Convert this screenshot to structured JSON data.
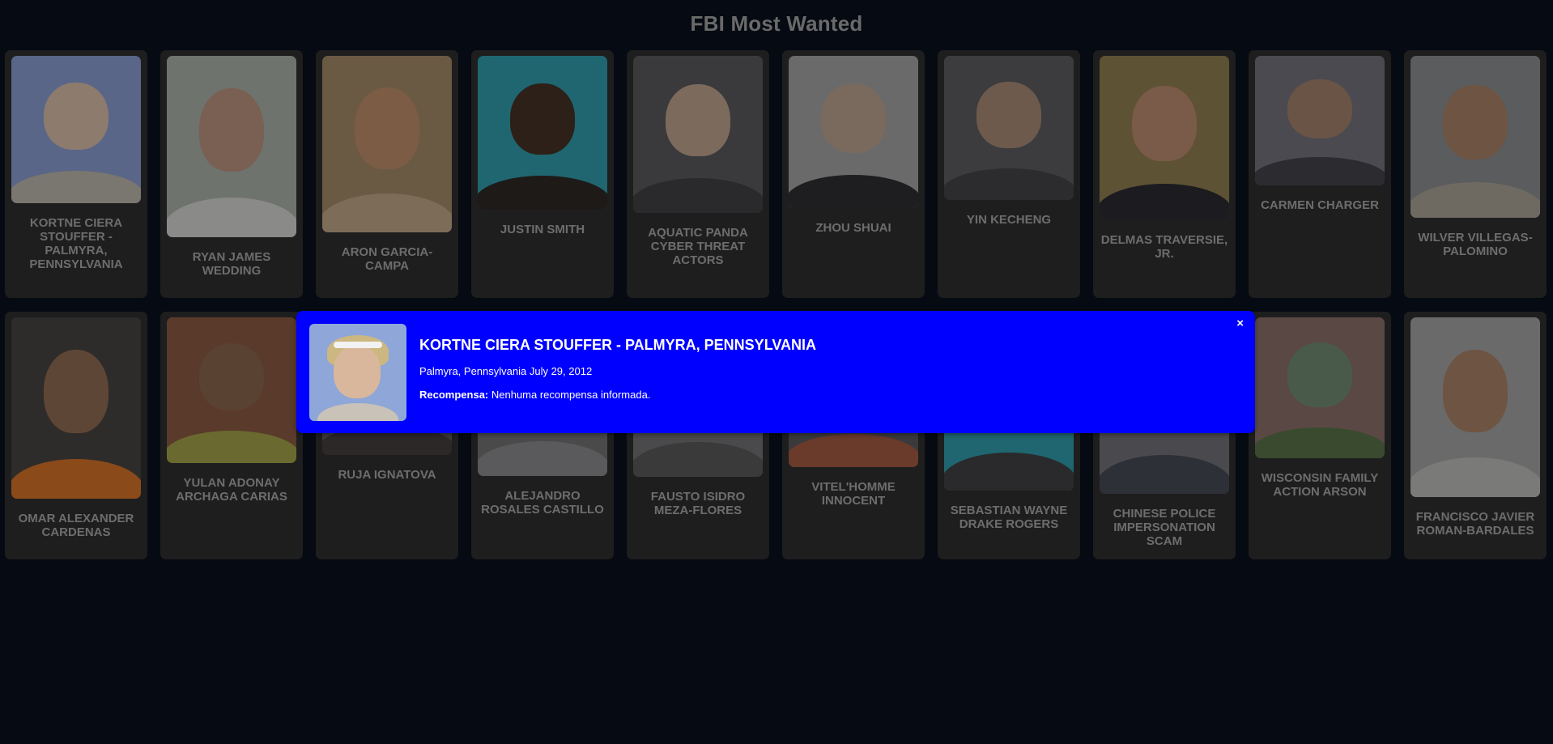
{
  "page": {
    "title": "FBI Most Wanted"
  },
  "cards": [
    {
      "name": "KORTNE CIERA STOUFFER - PALMYRA, PENNSYLVANIA",
      "photo_height": 182,
      "bg": "#5a6688",
      "skin": "#8d7b6e",
      "shirt": "#7a7670"
    },
    {
      "name": "RYAN JAMES WEDDING",
      "photo_height": 224,
      "bg": "#6e736e",
      "skin": "#7a6052",
      "shirt": "#8a8a88"
    },
    {
      "name": "ARON GARCIA-CAMPA",
      "photo_height": 218,
      "bg": "#6a5a44",
      "skin": "#7c5c44",
      "shirt": "#7c6c58"
    },
    {
      "name": "JUSTIN SMITH",
      "photo_height": 190,
      "bg": "#1f6670",
      "skin": "#2c2018",
      "shirt": "#1e1a18"
    },
    {
      "name": "AQUATIC PANDA CYBER THREAT ACTORS",
      "photo_height": 194,
      "bg": "#3a3a3c",
      "skin": "#7c6a5c",
      "shirt": "#2a2a2c"
    },
    {
      "name": "ZHOU SHUAI",
      "photo_height": 188,
      "bg": "#6a6a6a",
      "skin": "#7a6a5e",
      "shirt": "#1e1e20"
    },
    {
      "name": "YIN KECHENG",
      "photo_height": 178,
      "bg": "#3c3c3e",
      "skin": "#6e5a4c",
      "shirt": "#2c2c2e"
    },
    {
      "name": "DELMAS TRAVERSIE, JR.",
      "photo_height": 203,
      "bg": "#5e5234",
      "skin": "#7a5a48",
      "shirt": "#1c1c20"
    },
    {
      "name": "CARMEN CHARGER",
      "photo_height": 160,
      "bg": "#4a4a50",
      "skin": "#6a5446",
      "shirt": "#2c2c30"
    },
    {
      "name": "WILVER VILLEGAS-PALOMINO",
      "photo_height": 200,
      "bg": "#5a5c5e",
      "skin": "#6e5442",
      "shirt": "#6e6a62"
    },
    {
      "name": "OMAR ALEXANDER CARDENAS",
      "photo_height": 224,
      "bg": "#2e2c2a",
      "skin": "#5e4636",
      "shirt": "#8a4a1a"
    },
    {
      "name": "YULAN ADONAY ARCHAGA CARIAS",
      "photo_height": 180,
      "bg": "#5a3a2a",
      "skin": "#5a4232",
      "shirt": "#6a6a30"
    },
    {
      "name": "RUJA IGNATOVA",
      "photo_height": 170,
      "bg": "#3e3a3a",
      "skin": "#6e5a4c",
      "shirt": "#2c2828"
    },
    {
      "name": "ALEJANDRO ROSALES CASTILLO",
      "photo_height": 196,
      "bg": "#4a4a4a",
      "skin": "#6e5a4a",
      "shirt": "#5a5a5c"
    },
    {
      "name": "FAUSTO ISIDRO MEZA-FLORES",
      "photo_height": 197,
      "bg": "#4a4a4c",
      "skin": "#6a5240",
      "shirt": "#3a3a3a"
    },
    {
      "name": "VITEL'HOMME INNOCENT",
      "photo_height": 185,
      "bg": "#3a3a3c",
      "skin": "#3a2a20",
      "shirt": "#6a3a2a"
    },
    {
      "name": "SEBASTIAN WAYNE DRAKE ROGERS",
      "photo_height": 214,
      "bg": "#1f6670",
      "skin": "#7a6a5e",
      "shirt": "#2a2a2c"
    },
    {
      "name": "CHINESE POLICE IMPERSONATION SCAM",
      "photo_height": 218,
      "bg": "#4a4a4e",
      "skin": "#6a5a4c",
      "shirt": "#2e3038"
    },
    {
      "name": "WISCONSIN FAMILY ACTION ARSON",
      "photo_height": 174,
      "bg": "#5a4844",
      "skin": "#4a5a4a",
      "shirt": "#3a4a2e"
    },
    {
      "name": "FRANCISCO JAVIER ROMAN-BARDALES",
      "photo_height": 222,
      "bg": "#6a6a6a",
      "skin": "#6e5442",
      "shirt": "#7a7a78"
    }
  ],
  "modal": {
    "name": "KORTNE CIERA STOUFFER - PALMYRA, PENNSYLVANIA",
    "description": "Palmyra, Pennsylvania July 29, 2012",
    "reward_label": "Recompensa:",
    "reward_value": "Nenhuma recompensa informada.",
    "close_label": "×"
  }
}
